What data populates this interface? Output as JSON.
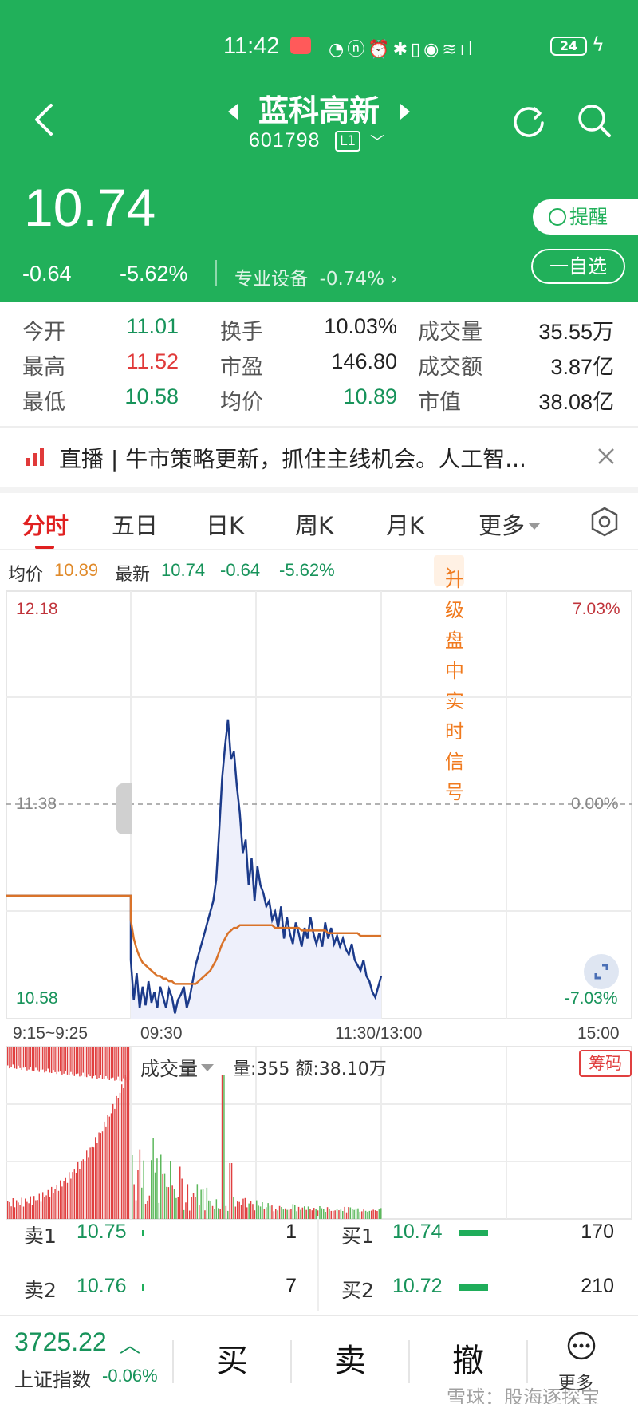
{
  "status": {
    "time": "11:42",
    "battery": "24"
  },
  "stock": {
    "name": "蓝科高新",
    "code": "601798",
    "level": "L1",
    "price": "10.74",
    "change": "-0.64",
    "change_pct": "-5.62%",
    "sector": "专业设备",
    "sector_pct": "-0.74%",
    "remind_label": "提醒",
    "watch_label": "一自选"
  },
  "stats": [
    [
      {
        "label": "今开",
        "value": "11.01",
        "color": "#17935a"
      },
      {
        "label": "换手",
        "value": "10.03%",
        "color": "#222222"
      },
      {
        "label": "成交量",
        "value": "35.55万",
        "color": "#222222"
      }
    ],
    [
      {
        "label": "最高",
        "value": "11.52",
        "color": "#e03a3a"
      },
      {
        "label": "市盈",
        "value": "146.80",
        "color": "#222222"
      },
      {
        "label": "成交额",
        "value": "3.87亿",
        "color": "#222222"
      }
    ],
    [
      {
        "label": "最低",
        "value": "10.58",
        "color": "#17935a"
      },
      {
        "label": "均价",
        "value": "10.89",
        "color": "#17935a"
      },
      {
        "label": "市值",
        "value": "38.08亿",
        "color": "#222222"
      }
    ]
  ],
  "news": {
    "text": "直播 | 牛市策略更新，抓住主线机会。人工智..."
  },
  "tabs": [
    "分时",
    "五日",
    "日K",
    "周K",
    "月K",
    "更多"
  ],
  "info": {
    "avg_label": "均价",
    "avg_value": "10.89",
    "latest_label": "最新",
    "latest_value": "10.74",
    "change": "-0.64",
    "change_pct": "-5.62%",
    "upgrade": "升级盘中实时信号"
  },
  "chart_axis": {
    "price_top": "12.18",
    "price_mid": "11.38",
    "price_bot": "10.58",
    "pct_top": "7.03%",
    "pct_mid": "0.00%",
    "pct_bot": "-7.03%",
    "time_pre": "9:15~9:25",
    "time_open": "09:30",
    "time_mid": "11:30/13:00",
    "time_close": "15:00"
  },
  "chart_data": {
    "type": "line",
    "ylim": [
      10.58,
      12.18
    ],
    "preclose": 11.38,
    "series": [
      {
        "name": "最新",
        "values": [
          11.04,
          11.04,
          11.04,
          11.04,
          11.04,
          11.04,
          10.8,
          10.65,
          10.75,
          10.62,
          10.7,
          10.63,
          10.72,
          10.64,
          10.68,
          10.62,
          10.7,
          10.66,
          10.62,
          10.69,
          10.66,
          10.6,
          10.65,
          10.67,
          10.7,
          10.62,
          10.66,
          10.72,
          10.78,
          10.82,
          10.86,
          10.9,
          10.94,
          10.98,
          11.02,
          11.1,
          11.28,
          11.48,
          11.6,
          11.7,
          11.55,
          11.58,
          11.45,
          11.35,
          11.2,
          11.25,
          11.08,
          11.18,
          11.02,
          11.15,
          11.08,
          11.05,
          11.0,
          11.02,
          10.95,
          10.98,
          10.92,
          11.0,
          10.88,
          10.96,
          10.9,
          10.86,
          10.94,
          10.9,
          10.85,
          10.92,
          10.88,
          10.96,
          10.9,
          10.86,
          10.9,
          10.85,
          10.94,
          10.88,
          10.92,
          10.86,
          10.89,
          10.85,
          10.88,
          10.84,
          10.82,
          10.86,
          10.8,
          10.78,
          10.76,
          10.8,
          10.74,
          10.72,
          10.68,
          10.66,
          10.7,
          10.74
        ]
      },
      {
        "name": "均价",
        "values": [
          11.04,
          11.04,
          11.04,
          11.04,
          11.04,
          11.04,
          10.95,
          10.88,
          10.84,
          10.81,
          10.79,
          10.78,
          10.77,
          10.76,
          10.75,
          10.74,
          10.74,
          10.73,
          10.73,
          10.72,
          10.72,
          10.71,
          10.71,
          10.71,
          10.71,
          10.71,
          10.71,
          10.71,
          10.71,
          10.72,
          10.73,
          10.74,
          10.75,
          10.76,
          10.78,
          10.8,
          10.83,
          10.86,
          10.88,
          10.9,
          10.91,
          10.92,
          10.92,
          10.93,
          10.93,
          10.93,
          10.93,
          10.93,
          10.93,
          10.93,
          10.93,
          10.93,
          10.93,
          10.93,
          10.93,
          10.92,
          10.92,
          10.92,
          10.92,
          10.92,
          10.92,
          10.92,
          10.92,
          10.92,
          10.91,
          10.91,
          10.91,
          10.91,
          10.91,
          10.91,
          10.91,
          10.91,
          10.91,
          10.9,
          10.9,
          10.9,
          10.9,
          10.9,
          10.9,
          10.9,
          10.9,
          10.9,
          10.9,
          10.9,
          10.89,
          10.89,
          10.89,
          10.89,
          10.89,
          10.89,
          10.89,
          10.89
        ]
      }
    ]
  },
  "volume": {
    "label": "成交量",
    "info": "量:355 额:38.10万",
    "chip": "筹码"
  },
  "order_book": {
    "sell": [
      {
        "label": "卖1",
        "price": "10.75",
        "qty": "1",
        "bar": 0.01
      },
      {
        "label": "卖2",
        "price": "10.76",
        "qty": "7",
        "bar": 0.01
      }
    ],
    "buy": [
      {
        "label": "买1",
        "price": "10.74",
        "qty": "170",
        "bar": 0.3
      },
      {
        "label": "买2",
        "price": "10.72",
        "qty": "210",
        "bar": 0.3
      }
    ]
  },
  "bottom": {
    "index_value": "3725.22",
    "index_name": "上证指数",
    "index_pct": "-0.06%",
    "buy": "买",
    "sell": "卖",
    "cancel": "撤",
    "more": "更多",
    "watermark": "雪球：股海逐探宝"
  }
}
